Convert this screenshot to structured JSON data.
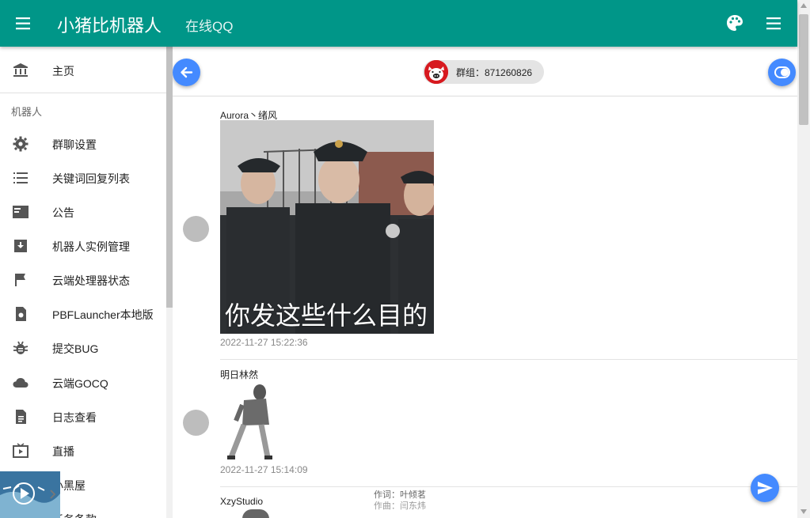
{
  "header": {
    "title": "小猪比机器人",
    "subtitle": "在线QQ"
  },
  "sidebar": {
    "home": {
      "label": "主页",
      "icon": "bank-icon"
    },
    "section_label": "机器人",
    "items": [
      {
        "label": "群聊设置",
        "icon": "gear-icon"
      },
      {
        "label": "关键词回复列表",
        "icon": "list-icon"
      },
      {
        "label": "公告",
        "icon": "announcement-icon"
      },
      {
        "label": "机器人实例管理",
        "icon": "archive-icon"
      },
      {
        "label": "云端处理器状态",
        "icon": "flag-icon"
      },
      {
        "label": "PBFLauncher本地版",
        "icon": "file-icon"
      },
      {
        "label": "提交BUG",
        "icon": "bug-icon"
      },
      {
        "label": "云端GOCQ",
        "icon": "cloud-icon"
      },
      {
        "label": "日志查看",
        "icon": "document-icon"
      },
      {
        "label": "直播",
        "icon": "tv-icon"
      },
      {
        "label": "小黑屋",
        "icon": "blackroom-icon"
      },
      {
        "label": "任务条款",
        "icon": "task-icon"
      }
    ]
  },
  "chat": {
    "group_label": "群组：871260826",
    "messages": [
      {
        "sender": "Aurora丶绪风",
        "caption": "你发这些什么目的",
        "time": "2022-11-27 15:22:36"
      },
      {
        "sender": "明日林然",
        "time": "2022-11-27 15:14:09"
      },
      {
        "sender": "XzyStudio"
      }
    ]
  },
  "music_player": {
    "lyric_line1": "作词：叶倾茗",
    "lyric_line2": "作曲：闫东炜"
  },
  "colors": {
    "appbar": "#009688",
    "fab": "#448aff",
    "avatar_placeholder": "#bdbdbd"
  }
}
